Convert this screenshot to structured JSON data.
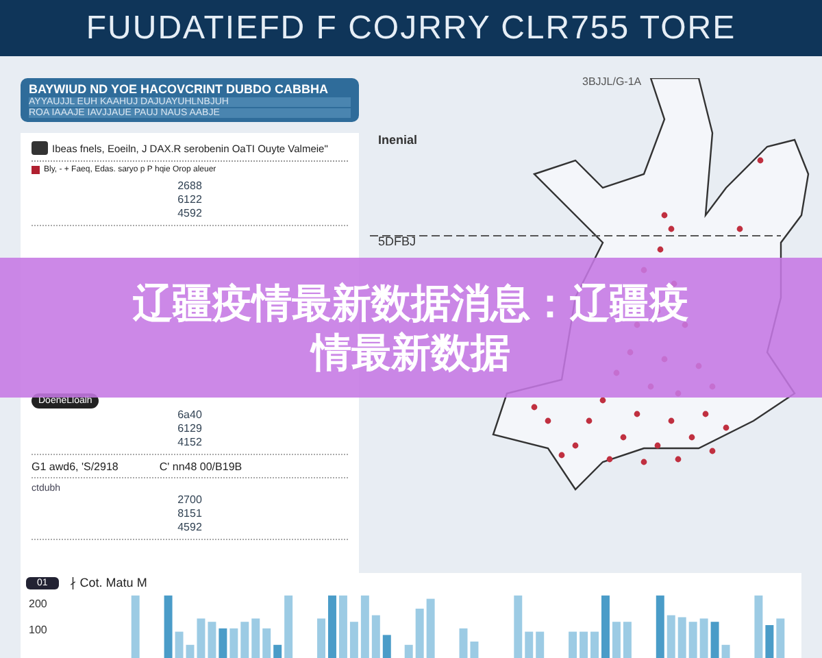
{
  "header": {
    "title": "FUUDATIEFD F COJRRY CLR755 TORE"
  },
  "left_panel": {
    "banner_lines": [
      "BAYWIUD ND YOE HACOVCRINT DUBDO CABBHA",
      "AYYAUJJL EUH KAAHUJ  DAJUAYUHLNBJUH",
      "ROA  IAAAJE  IAVJJAUE  PAUJ  NAUS  AABJE"
    ],
    "heading": "Ibeas fnels, Eoeiln, J DAX.R serobenin OaTI Ouyte Valmeie\"",
    "subheading": "Bly, - + Faeq, Edas. saryo p P hqie Orop aleuer",
    "sections": [
      {
        "kind": "plain",
        "numbers": [
          "2688",
          "6122",
          "4592"
        ]
      },
      {
        "kind": "dark-pill",
        "label": "DoeneLloalh",
        "numbers": [
          "6a40",
          "6129",
          "4152"
        ]
      },
      {
        "kind": "pair",
        "label": "G1 awd6, 'S/2918",
        "label_2": "C' nn48 00/B19B"
      },
      {
        "kind": "caption",
        "label": "ctdubh",
        "numbers": [
          "2700",
          "8151",
          "4592"
        ]
      }
    ]
  },
  "map_panel": {
    "legend": "Inenial",
    "top_label": "3BJJL/G-1A",
    "divider_label": "5DFBJ"
  },
  "chart_section": {
    "badge": "01",
    "title": "∤ Cot. Matu M",
    "yticks": [
      "200",
      "100"
    ]
  },
  "overlay_banner": {
    "lines": [
      "辽疆疫情最新数据消息：辽疆疫",
      "情最新数据"
    ]
  }
}
